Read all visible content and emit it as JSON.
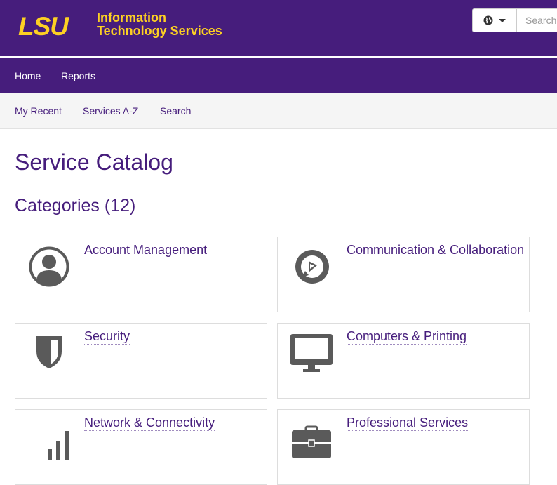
{
  "brand": {
    "logo": "LSU",
    "org_name": "Information\nTechnology Services",
    "colors": {
      "purple": "#461d7c",
      "gold": "#fdd023",
      "icon_gray": "#5a5a5a"
    }
  },
  "search": {
    "placeholder": "Search",
    "lang_icon": "globe-icon"
  },
  "nav_primary": [
    {
      "label": "Home"
    },
    {
      "label": "Reports"
    }
  ],
  "nav_secondary": [
    {
      "label": "My Recent"
    },
    {
      "label": "Services A-Z"
    },
    {
      "label": "Search"
    }
  ],
  "page": {
    "title": "Service Catalog",
    "categories_heading": "Categories (12)"
  },
  "categories": [
    {
      "label": "Account Management",
      "icon": "user-circle-icon"
    },
    {
      "label": "Communication & Collaboration",
      "icon": "speech-play-icon"
    },
    {
      "label": "Security",
      "icon": "shield-icon"
    },
    {
      "label": "Computers & Printing",
      "icon": "monitor-icon"
    },
    {
      "label": "Network & Connectivity",
      "icon": "signal-bars-icon"
    },
    {
      "label": "Professional Services",
      "icon": "briefcase-icon"
    }
  ]
}
